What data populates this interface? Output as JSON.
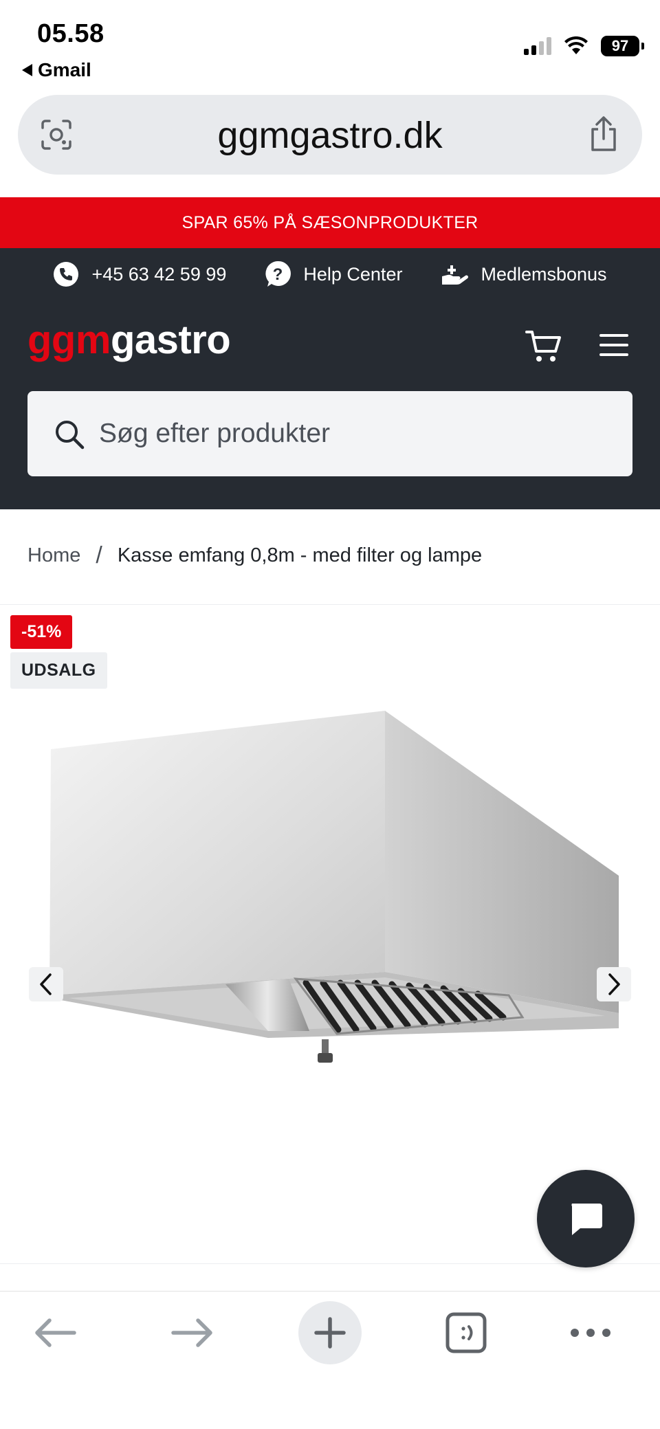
{
  "status_bar": {
    "time": "05.58",
    "back_app": "Gmail",
    "battery": "97"
  },
  "browser": {
    "url": "ggmgastro.dk"
  },
  "promo_banner": "SPAR 65% PÅ SÆSONPRODUKTER",
  "header": {
    "phone": "+45 63 42 59 99",
    "help": "Help Center",
    "bonus": "Medlemsbonus",
    "logo_part1": "ggm",
    "logo_part2": "gastro",
    "search_placeholder": "Søg efter produkter"
  },
  "breadcrumb": {
    "home": "Home",
    "separator": "/",
    "current": "Kasse emfang 0,8m - med filter og lampe"
  },
  "product": {
    "discount_badge": "-51%",
    "sale_badge": "UDSALG"
  },
  "colors": {
    "brand_red": "#e30613",
    "header_dark": "#262b32"
  },
  "icons": [
    "camera-search-icon",
    "share-icon",
    "phone-icon",
    "help-icon",
    "bonus-hand-icon",
    "cart-icon",
    "menu-icon",
    "search-icon",
    "chevron-left-icon",
    "chevron-right-icon",
    "chat-icon",
    "back-arrow-icon",
    "forward-arrow-icon",
    "plus-icon",
    "tabs-icon",
    "more-icon"
  ]
}
